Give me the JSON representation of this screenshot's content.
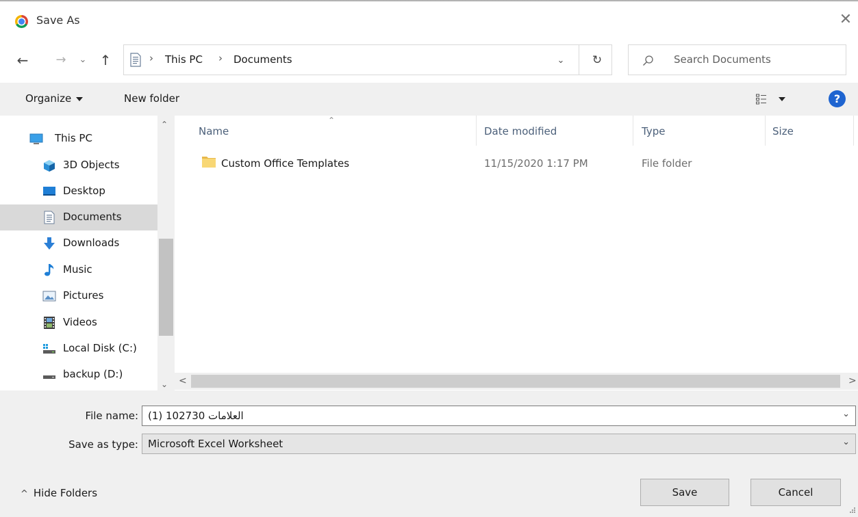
{
  "window": {
    "title": "Save As",
    "close_glyph": "✕"
  },
  "nav": {
    "back_glyph": "←",
    "forward_glyph": "→",
    "recent_glyph": "⌄",
    "up_glyph": "↑"
  },
  "address_bar": {
    "crumbs": [
      "This PC",
      "Documents"
    ],
    "separator": "›",
    "dropdown_glyph": "⌄",
    "refresh_glyph": "↻"
  },
  "search": {
    "placeholder": "Search Documents"
  },
  "toolbar": {
    "organize_label": "Organize",
    "new_folder_label": "New folder",
    "help_label": "?"
  },
  "sidebar": {
    "items": [
      {
        "label": "This PC",
        "icon": "monitor-icon"
      },
      {
        "label": "3D Objects",
        "icon": "cube-icon"
      },
      {
        "label": "Desktop",
        "icon": "desktop-icon"
      },
      {
        "label": "Documents",
        "icon": "document-icon",
        "selected": true
      },
      {
        "label": "Downloads",
        "icon": "download-arrow-icon"
      },
      {
        "label": "Music",
        "icon": "music-note-icon"
      },
      {
        "label": "Pictures",
        "icon": "picture-icon"
      },
      {
        "label": "Videos",
        "icon": "film-icon"
      },
      {
        "label": "Local Disk (C:)",
        "icon": "windows-drive-icon"
      },
      {
        "label": "backup (D:)",
        "icon": "drive-icon"
      }
    ],
    "scroll_up_glyph": "⌃",
    "scroll_down_glyph": "⌄"
  },
  "file_list": {
    "columns": [
      "Name",
      "Date modified",
      "Type",
      "Size"
    ],
    "sort_glyph": "⌃",
    "rows": [
      {
        "name": "Custom Office Templates",
        "date_modified": "11/15/2020 1:17 PM",
        "type": "File folder",
        "size": ""
      }
    ],
    "scroll_left_glyph": "<",
    "scroll_right_glyph": ">"
  },
  "form": {
    "file_name_label": "File name:",
    "file_name_value": "(1) العلامات 102730",
    "save_as_type_label": "Save as type:",
    "save_as_type_value": "Microsoft Excel Worksheet",
    "chevron_glyph": "⌄"
  },
  "footer": {
    "hide_folders_glyph": "^",
    "hide_folders_label": "Hide Folders",
    "save_label": "Save",
    "cancel_label": "Cancel"
  },
  "colors": {
    "accent": "#1e64d0",
    "folder": "#f5c84c",
    "selection": "#d9d9d9"
  }
}
